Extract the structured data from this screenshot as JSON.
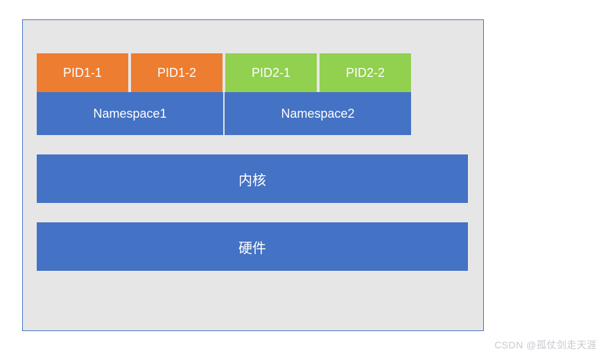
{
  "diagram": {
    "pids": {
      "ns1": [
        "PID1-1",
        "PID1-2"
      ],
      "ns2": [
        "PID2-1",
        "PID2-2"
      ]
    },
    "namespaces": [
      "Namespace1",
      "Namespace2"
    ],
    "kernel": "内核",
    "hardware": "硬件"
  },
  "watermark": "CSDN @孤仗剑走天涯",
  "colors": {
    "border": "#4472c4",
    "containerBg": "#e7e6e6",
    "blue": "#4472c4",
    "orange": "#ed7d31",
    "green": "#92d050"
  }
}
